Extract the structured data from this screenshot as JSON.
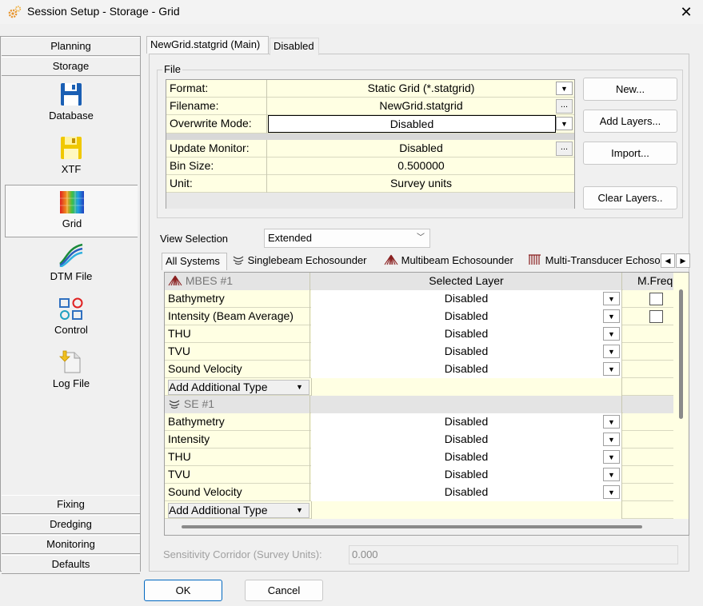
{
  "window": {
    "title": "Session Setup - Storage -  Grid",
    "close": "✕"
  },
  "sidebar": {
    "categories_top": [
      "Planning",
      "Storage"
    ],
    "items": [
      {
        "label": "Database",
        "icon": "floppy-disk-icon"
      },
      {
        "label": "XTF",
        "icon": "xtf-disk-icon"
      },
      {
        "label": "Grid",
        "icon": "grid-colormap-icon",
        "selected": true
      },
      {
        "label": "DTM File",
        "icon": "dtm-wave-icon"
      },
      {
        "label": "Control",
        "icon": "shapes-control-icon"
      },
      {
        "label": "Log File",
        "icon": "log-file-icon"
      }
    ],
    "categories_bottom": [
      "Fixing",
      "Dredging",
      "Monitoring",
      "Defaults"
    ]
  },
  "tabs": [
    "NewGrid.statgrid (Main)",
    "Disabled"
  ],
  "file": {
    "group_label": "File",
    "rows": [
      {
        "key": "Format:",
        "value": "Static Grid (*.statgrid)"
      },
      {
        "key": "Filename:",
        "value": "NewGrid.statgrid"
      },
      {
        "key": "Overwrite Mode:",
        "value": "Disabled"
      },
      {
        "key": "Update Monitor:",
        "value": "Disabled"
      },
      {
        "key": "Bin Size:",
        "value": "0.500000"
      },
      {
        "key": "Unit:",
        "value": "Survey units"
      }
    ],
    "buttons": {
      "new": "New...",
      "add_layers": "Add Layers...",
      "import": "Import...",
      "clear_layers": "Clear Layers.."
    }
  },
  "view": {
    "label": "View Selection",
    "value": "Extended"
  },
  "system_tabs": [
    "All Systems",
    "Singlebeam Echosounder",
    "Multibeam Echosounder",
    "Multi-Transducer Echosounder"
  ],
  "grid": {
    "col_layer": "Selected Layer",
    "col_freq": "M.Freq",
    "mbes": {
      "name": "MBES #1",
      "rows": [
        {
          "key": "Bathymetry",
          "value": "Disabled"
        },
        {
          "key": "Intensity (Beam Average)",
          "value": "Disabled"
        },
        {
          "key": "THU",
          "value": "Disabled"
        },
        {
          "key": "TVU",
          "value": "Disabled"
        },
        {
          "key": "Sound Velocity",
          "value": "Disabled"
        }
      ]
    },
    "se": {
      "name": "SE #1",
      "rows": [
        {
          "key": "Bathymetry",
          "value": "Disabled"
        },
        {
          "key": "Intensity",
          "value": "Disabled"
        },
        {
          "key": "THU",
          "value": "Disabled"
        },
        {
          "key": "TVU",
          "value": "Disabled"
        },
        {
          "key": "Sound Velocity",
          "value": "Disabled"
        }
      ]
    },
    "add_type": "Add Additional Type"
  },
  "sensitivity": {
    "label": "Sensitivity Corridor (Survey Units):",
    "value": "0.000"
  },
  "footer": {
    "ok": "OK",
    "cancel": "Cancel"
  },
  "colors": {
    "grid_bg": "#ffffe3",
    "accent": "#0067c0"
  }
}
